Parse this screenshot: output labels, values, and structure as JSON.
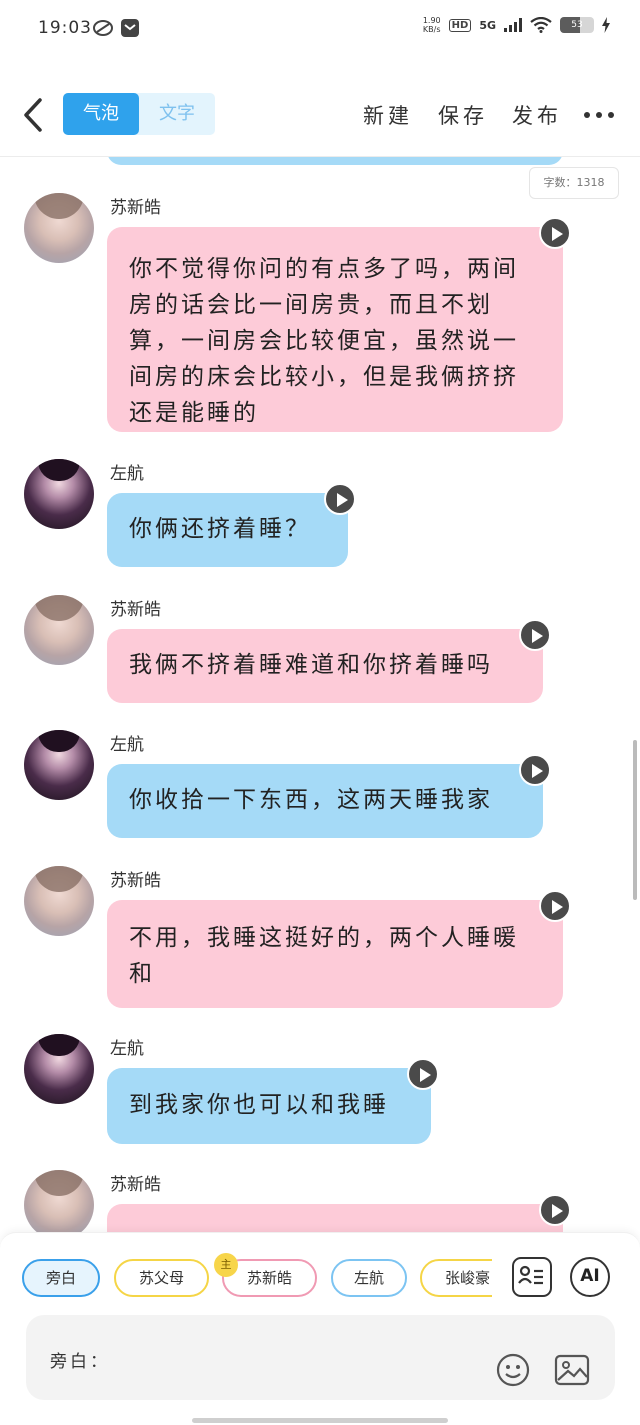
{
  "status": {
    "time": "19:03",
    "net_speed_value": "1.90",
    "net_speed_unit": "KB/s",
    "hd": "HD",
    "signal": "5G",
    "battery": "53"
  },
  "topbar": {
    "tab_bubble": "气泡",
    "tab_text": "文字",
    "new": "新建",
    "save": "保存",
    "publish": "发布"
  },
  "word_count": "字数：1318",
  "messages": [
    {
      "name": "苏新皓",
      "text": "你不觉得你问的有点多了吗，两间房的话会比一间房贵，而且不划算，一间房会比较便宜，虽然说一间房的床会比较小，但是我俩挤挤还是能睡的",
      "color": "pink"
    },
    {
      "name": "左航",
      "text": "你俩还挤着睡？",
      "color": "blue"
    },
    {
      "name": "苏新皓",
      "text": "我俩不挤着睡难道和你挤着睡吗",
      "color": "pink"
    },
    {
      "name": "左航",
      "text": "你收拾一下东西，这两天睡我家",
      "color": "blue"
    },
    {
      "name": "苏新皓",
      "text": "不用，我睡这挺好的，两个人睡暖和",
      "color": "pink"
    },
    {
      "name": "左航",
      "text": "到我家你也可以和我睡",
      "color": "blue"
    },
    {
      "name": "苏新皓",
      "text": "",
      "color": "pink"
    }
  ],
  "roles": [
    "旁白",
    "苏父母",
    "苏新皓",
    "左航",
    "张峻豪"
  ],
  "crown_label": "主",
  "ai_label": "AI",
  "input_label": "旁白：",
  "colors": {
    "accent": "#2fa2ec",
    "pink_bubble": "#fdcbd8",
    "blue_bubble": "#a5daf7"
  }
}
